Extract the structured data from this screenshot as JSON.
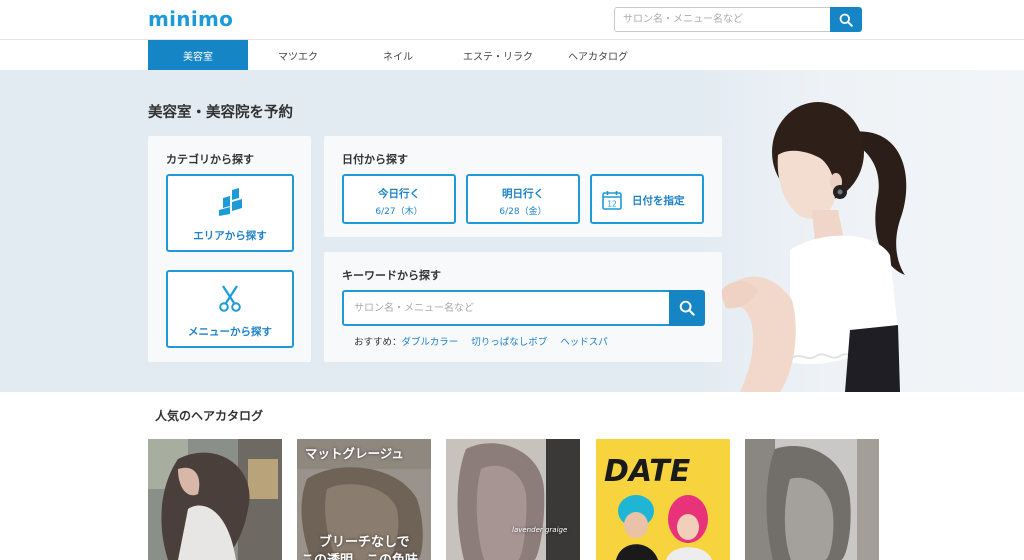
{
  "header": {
    "logo": "minimo",
    "search_placeholder": "サロン名・メニュー名など"
  },
  "nav": {
    "tabs": [
      {
        "label": "美容室",
        "active": true
      },
      {
        "label": "マツエク",
        "active": false
      },
      {
        "label": "ネイル",
        "active": false
      },
      {
        "label": "エステ・リラク",
        "active": false
      },
      {
        "label": "ヘアカタログ",
        "active": false
      }
    ]
  },
  "hero": {
    "title": "美容室・美容院を予約",
    "category": {
      "label": "カテゴリから探す",
      "area_button": "エリアから探す",
      "menu_button": "メニューから探す"
    },
    "date": {
      "label": "日付から探す",
      "today": {
        "title": "今日行く",
        "date": "6/27（木）"
      },
      "tomorrow": {
        "title": "明日行く",
        "date": "6/28（金）"
      },
      "specify": {
        "label": "日付を指定",
        "calendar_day": "12"
      }
    },
    "keyword": {
      "label": "キーワードから探す",
      "placeholder": "サロン名・メニュー名など",
      "recommend_label": "おすすめ：",
      "recommend_links": [
        "ダブルカラー",
        "切りっぱなしボブ",
        "ヘッドスパ"
      ]
    }
  },
  "catalog": {
    "title": "人気のヘアカタログ",
    "items": [
      {
        "caption_top": "",
        "caption_bottom": "",
        "watermark": ""
      },
      {
        "caption_top": "マットグレージュ",
        "caption_bottom": "ブリーチなしで",
        "caption_bottom2": "この透明、この色味",
        "watermark": ""
      },
      {
        "caption_top": "",
        "caption_bottom": "",
        "watermark": "lavender graige"
      },
      {
        "caption_top": "DATE",
        "caption_bottom": "",
        "watermark": ""
      },
      {
        "caption_top": "",
        "caption_bottom": "",
        "watermark": ""
      }
    ]
  },
  "colors": {
    "brand": "#1e9bd7",
    "accent": "#1585c6",
    "hero_bg": "#e3ebf2"
  },
  "icons": {
    "search": "search-icon",
    "area": "map-area-icon",
    "menu": "scissors-icon",
    "calendar": "calendar-icon"
  }
}
